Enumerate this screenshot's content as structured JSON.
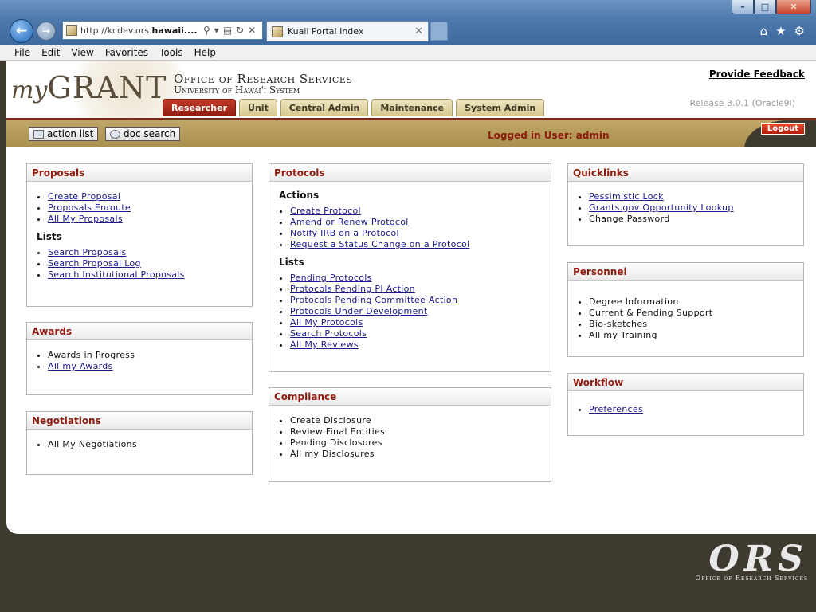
{
  "browser": {
    "url_prefix": "http://kcdev.ors.",
    "url_domain": "hawaii....",
    "tab_title": "Kuali Portal Index",
    "menu": [
      "File",
      "Edit",
      "View",
      "Favorites",
      "Tools",
      "Help"
    ]
  },
  "header": {
    "logo_my": "my",
    "logo_grant": "GRANT",
    "org_line1": "Office of Research Services",
    "org_line2": "University of Hawai'i System",
    "feedback": "Provide Feedback",
    "release": "Release 3.0.1 (Oracle9i)",
    "tabs": [
      "Researcher",
      "Unit",
      "Central Admin",
      "Maintenance",
      "System Admin"
    ]
  },
  "toolbar": {
    "action_list": "action list",
    "doc_search": "doc search",
    "logged_in": "Logged in User: admin",
    "logout": "Logout"
  },
  "portlets": {
    "proposals": {
      "title": "Proposals",
      "items": [
        "Create Proposal",
        "Proposals Enroute",
        "All My Proposals"
      ],
      "lists_label": "Lists",
      "lists": [
        "Search Proposals",
        "Search Proposal Log",
        "Search Institutional Proposals"
      ]
    },
    "awards": {
      "title": "Awards",
      "items": [
        "Awards in Progress",
        "All my Awards"
      ]
    },
    "negotiations": {
      "title": "Negotiations",
      "items": [
        "All My Negotiations"
      ]
    },
    "protocols": {
      "title": "Protocols",
      "actions_label": "Actions",
      "actions": [
        "Create Protocol",
        "Amend or Renew Protocol",
        "Notify IRB on a Protocol",
        "Request a Status Change on a Protocol"
      ],
      "lists_label": "Lists",
      "lists": [
        "Pending Protocols",
        "Protocols Pending PI Action",
        "Protocols Pending Committee Action",
        "Protocols Under Development",
        "All My Protocols",
        "Search Protocols",
        "All My Reviews"
      ]
    },
    "compliance": {
      "title": "Compliance",
      "items": [
        "Create Disclosure",
        "Review Final Entities",
        "Pending Disclosures",
        "All my Disclosures"
      ]
    },
    "quicklinks": {
      "title": "Quicklinks",
      "items": [
        "Pessimistic Lock",
        "Grants.gov Opportunity Lookup",
        "Change Password"
      ]
    },
    "personnel": {
      "title": "Personnel",
      "items": [
        "Degree Information",
        "Current & Pending Support",
        "Bio-sketches",
        "All my Training"
      ]
    },
    "workflow": {
      "title": "Workflow",
      "items": [
        "Preferences"
      ]
    }
  },
  "footer": {
    "logo_big": "ORS",
    "logo_small": "Office of Research Services"
  },
  "colors": {
    "accent": "#8e1c0f",
    "tab_bg": "#d5c78f",
    "toolbar": "#b39a59",
    "page_bg": "#3f3a30"
  }
}
